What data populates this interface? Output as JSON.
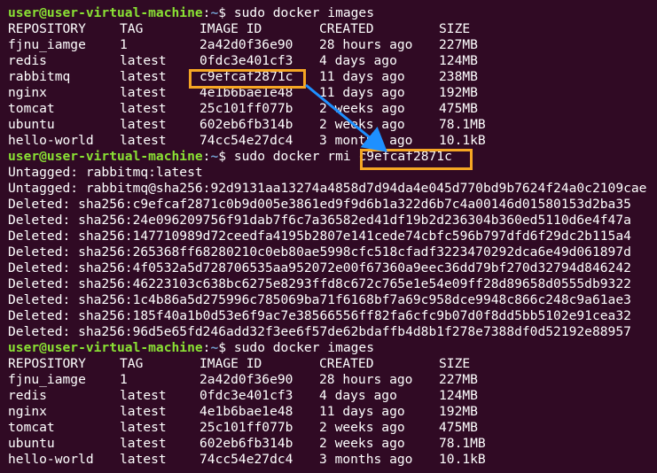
{
  "prompt": {
    "user": "user@user-virtual-machine",
    "path": "~",
    "symbol": "$"
  },
  "commands": {
    "first": "sudo docker images",
    "second_prefix": "sudo docker rmi ",
    "second_arg": "c9efcaf2871c",
    "third": "sudo docker images"
  },
  "table_headers": [
    "REPOSITORY",
    "TAG",
    "IMAGE ID",
    "CREATED",
    "SIZE"
  ],
  "images_before": [
    [
      "fjnu_iamge",
      "1",
      "2a42d0f36e90",
      "28 hours ago",
      "227MB"
    ],
    [
      "redis",
      "latest",
      "0fdc3e401cf3",
      "4 days ago",
      "124MB"
    ],
    [
      "rabbitmq",
      "latest",
      "c9efcaf2871c",
      "11 days ago",
      "238MB"
    ],
    [
      "nginx",
      "latest",
      "4e1b6bae1e48",
      "11 days ago",
      "192MB"
    ],
    [
      "tomcat",
      "latest",
      "25c101ff077b",
      "2 weeks ago",
      "475MB"
    ],
    [
      "ubuntu",
      "latest",
      "602eb6fb314b",
      "2 weeks ago",
      "78.1MB"
    ],
    [
      "hello-world",
      "latest",
      "74cc54e27dc4",
      "3 months ago",
      "10.1kB"
    ]
  ],
  "rmi_output": [
    "Untagged: rabbitmq:latest",
    "Untagged: rabbitmq@sha256:92d9131aa13274a4858d7d94da4e045d770bd9b7624f24a0c2109cae",
    "Deleted: sha256:c9efcaf2871c0b9d005e3861ed9f9d6b1a322d6b7c4a00146d01580153d2ba35",
    "Deleted: sha256:24e096209756f91dab7f6c7a36582ed41df19b2d236304b360ed5110d6e4f47a",
    "Deleted: sha256:147710989d72ceedfa4195b2807e141cede74cbfc596b797dfd6f29dc2b115a4",
    "Deleted: sha256:265368ff68280210c0eb80ae5998cfc518cfadf3223470292dca6e49d061897d",
    "Deleted: sha256:4f0532a5d728706535aa952072e00f67360a9eec36dd79bf270d32794d846242",
    "Deleted: sha256:46223103c638bc6275e8293ffd8c672c765e1e54e09ff28d89658d0555db9322",
    "Deleted: sha256:1c4b86a5d275996c785069ba71f6168bf7a69c958dce9948c866c248c9a61ae3",
    "Deleted: sha256:185f40a1b0d53e6f9ac7e38566556ff82fa6cfc9b07d0f8dd5bb5102e91cea32",
    "Deleted: sha256:96d5e65fd246add32f3ee6f57de62bdaffb4d8b1f278e7388df0d52192e88957"
  ],
  "images_after": [
    [
      "fjnu_iamge",
      "1",
      "2a42d0f36e90",
      "28 hours ago",
      "227MB"
    ],
    [
      "redis",
      "latest",
      "0fdc3e401cf3",
      "4 days ago",
      "124MB"
    ],
    [
      "nginx",
      "latest",
      "4e1b6bae1e48",
      "11 days ago",
      "192MB"
    ],
    [
      "tomcat",
      "latest",
      "25c101ff077b",
      "2 weeks ago",
      "475MB"
    ],
    [
      "ubuntu",
      "latest",
      "602eb6fb314b",
      "2 weeks ago",
      "78.1MB"
    ],
    [
      "hello-world",
      "latest",
      "74cc54e27dc4",
      "3 months ago",
      "10.1kB"
    ]
  ],
  "colors": {
    "background": "#300a24",
    "text": "#ffffff",
    "prompt_user": "#8ae234",
    "prompt_path": "#729fcf",
    "highlight_box": "#f5a623",
    "arrow": "#1e90ff"
  }
}
